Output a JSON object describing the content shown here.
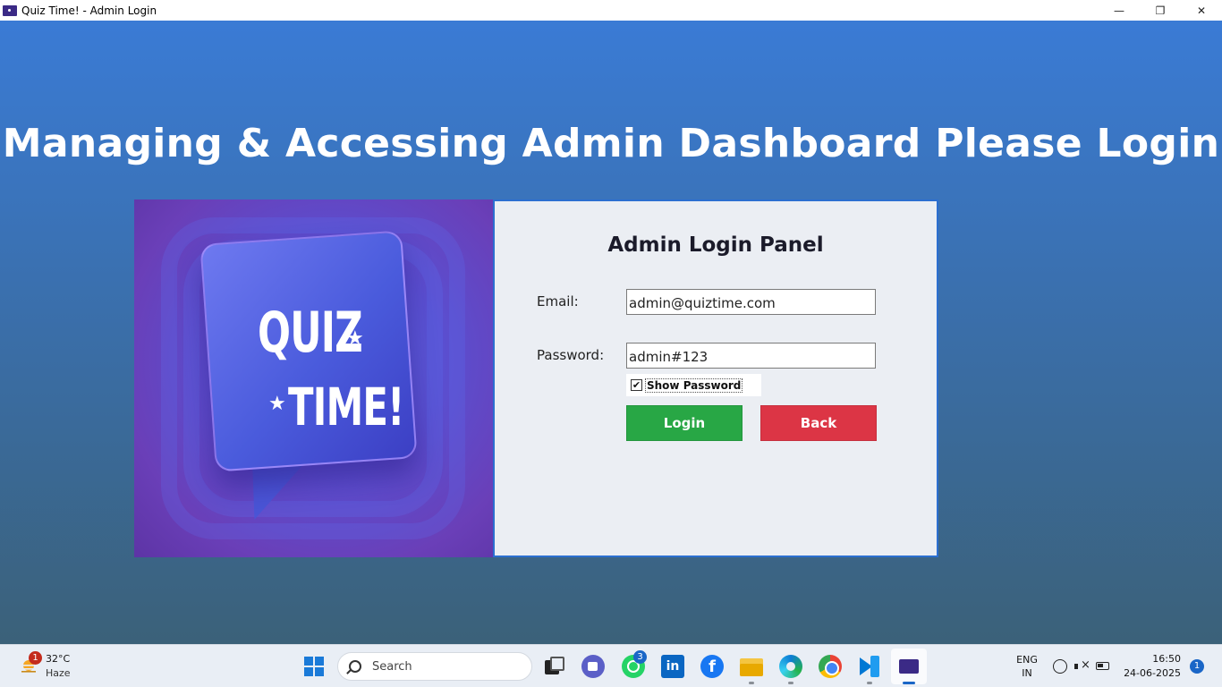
{
  "window": {
    "title": "Quiz Time! - Admin Login",
    "minimize": "—",
    "maximize": "❐",
    "close": "✕"
  },
  "page": {
    "headline": "Managing & Accessing Admin Dashboard Please Login"
  },
  "hero": {
    "line1": "QUIZ",
    "line2": "TIME!",
    "star": "★"
  },
  "login_panel": {
    "title": "Admin Login Panel",
    "email_label": "Email:",
    "email_value": "admin@quiztime.com",
    "password_label": "Password:",
    "password_value": "admin#123",
    "show_password_label": "Show Password",
    "show_password_checked": "✔",
    "login_button": "Login",
    "back_button": "Back"
  },
  "colors": {
    "login_button": "#28a745",
    "back_button": "#dc3545",
    "panel_border": "#2c6fd0"
  },
  "taskbar": {
    "weather_temp": "32°C",
    "weather_condition": "Haze",
    "weather_badge": "1",
    "search_placeholder": "Search",
    "whatsapp_badge": "3",
    "linkedin_label": "in",
    "facebook_label": "f",
    "language": "ENG",
    "region": "IN",
    "time": "16:50",
    "date": "24-06-2025",
    "notification_count": "1"
  }
}
